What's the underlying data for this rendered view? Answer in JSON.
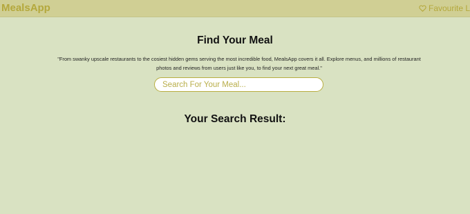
{
  "navbar": {
    "brand": "MealsApp",
    "favourite_label": "Favourite Lis",
    "favourite_icon": "heart-outline-icon",
    "accent_color": "#b4a83c",
    "background_color": "#d0cf94"
  },
  "main": {
    "heading": "Find Your Meal",
    "description": "\"From swanky upscale restaurants to the cosiest hidden gems serving the most incredible food, MealsApp covers it all. Explore menus, and millions of restaurant photos and reviews from users just like you, to find your next great meal.\"",
    "search": {
      "placeholder": "Search For Your Meal...",
      "value": ""
    },
    "results_heading": "Your Search Result:"
  },
  "page": {
    "background_color": "#d9e2c2"
  }
}
